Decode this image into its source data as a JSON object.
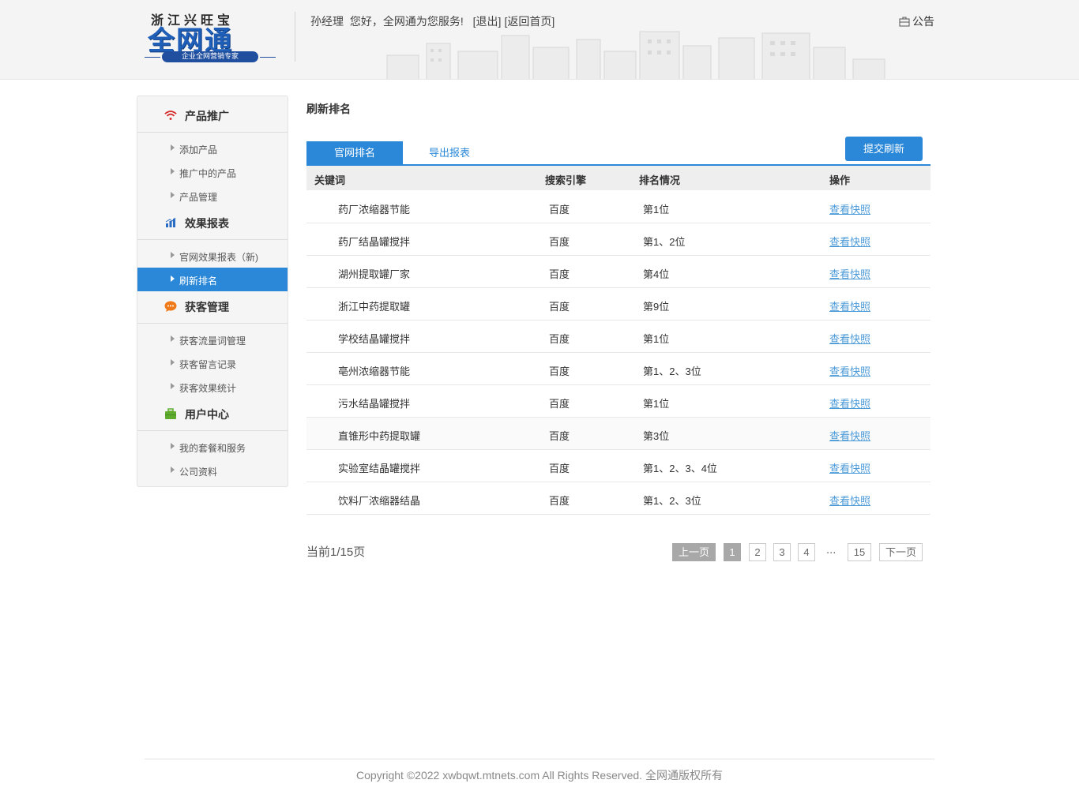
{
  "header": {
    "logo": {
      "top_text": "浙江兴旺宝",
      "main_text": "全网通",
      "badge_text": "企业全网营销专家"
    },
    "user_name": "孙经理",
    "greeting": "您好，全网通为您服务!",
    "logout_link": "[退出]",
    "home_link": "[返回首页]",
    "notice_label": "公告"
  },
  "sidebar": {
    "groups": [
      {
        "label": "产品推广",
        "icon": "wifi-icon",
        "items": [
          {
            "label": "添加产品"
          },
          {
            "label": "推广中的产品"
          },
          {
            "label": "产品管理"
          }
        ]
      },
      {
        "label": "效果报表",
        "icon": "bar-chart-icon",
        "items": [
          {
            "label": "官网效果报表（新)"
          },
          {
            "label": "刷新排名",
            "active": true
          }
        ]
      },
      {
        "label": "获客管理",
        "icon": "chat-bubble-icon",
        "items": [
          {
            "label": "获客流量词管理"
          },
          {
            "label": "获客留言记录"
          },
          {
            "label": "获客效果统计"
          }
        ]
      },
      {
        "label": "用户中心",
        "icon": "briefcase-icon",
        "items": [
          {
            "label": "我的套餐和服务"
          },
          {
            "label": "公司资料"
          }
        ]
      }
    ]
  },
  "main": {
    "title": "刷新排名",
    "tabs": [
      {
        "label": "官网排名",
        "active": true
      },
      {
        "label": "导出报表"
      }
    ],
    "submit_button": "提交刷新",
    "table": {
      "headers": [
        "关键词",
        "搜索引擎",
        "排名情况",
        "操作"
      ],
      "rows": [
        {
          "keyword": "药厂浓缩器节能",
          "engine": "百度",
          "rank": "第1位",
          "action": "查看快照"
        },
        {
          "keyword": "药厂结晶罐搅拌",
          "engine": "百度",
          "rank": "第1、2位",
          "action": "查看快照"
        },
        {
          "keyword": "湖州提取罐厂家",
          "engine": "百度",
          "rank": "第4位",
          "action": "查看快照"
        },
        {
          "keyword": "浙江中药提取罐",
          "engine": "百度",
          "rank": "第9位",
          "action": "查看快照"
        },
        {
          "keyword": "学校结晶罐搅拌",
          "engine": "百度",
          "rank": "第1位",
          "action": "查看快照"
        },
        {
          "keyword": "亳州浓缩器节能",
          "engine": "百度",
          "rank": "第1、2、3位",
          "action": "查看快照"
        },
        {
          "keyword": "污水结晶罐搅拌",
          "engine": "百度",
          "rank": "第1位",
          "action": "查看快照"
        },
        {
          "keyword": "直锥形中药提取罐",
          "engine": "百度",
          "rank": "第3位",
          "action": "查看快照"
        },
        {
          "keyword": "实验室结晶罐搅拌",
          "engine": "百度",
          "rank": "第1、2、3、4位",
          "action": "查看快照"
        },
        {
          "keyword": "饮料厂浓缩器结晶",
          "engine": "百度",
          "rank": "第1、2、3位",
          "action": "查看快照"
        }
      ]
    },
    "pagination": {
      "info": "当前1/15页",
      "prev": "上一页",
      "pages": [
        "1",
        "2",
        "3",
        "4"
      ],
      "ellipsis": "...",
      "last": "15",
      "next": "下一页"
    }
  },
  "footer": {
    "copyright": "Copyright ©2022 xwbqwt.mtnets.com All Rights Reserved. 全网通版权所有"
  },
  "colors": {
    "accent": "#2b88d8",
    "link": "#4b9ad8",
    "logo_blue": "#1f5fb8",
    "header_bg": "#f4f4f4"
  }
}
